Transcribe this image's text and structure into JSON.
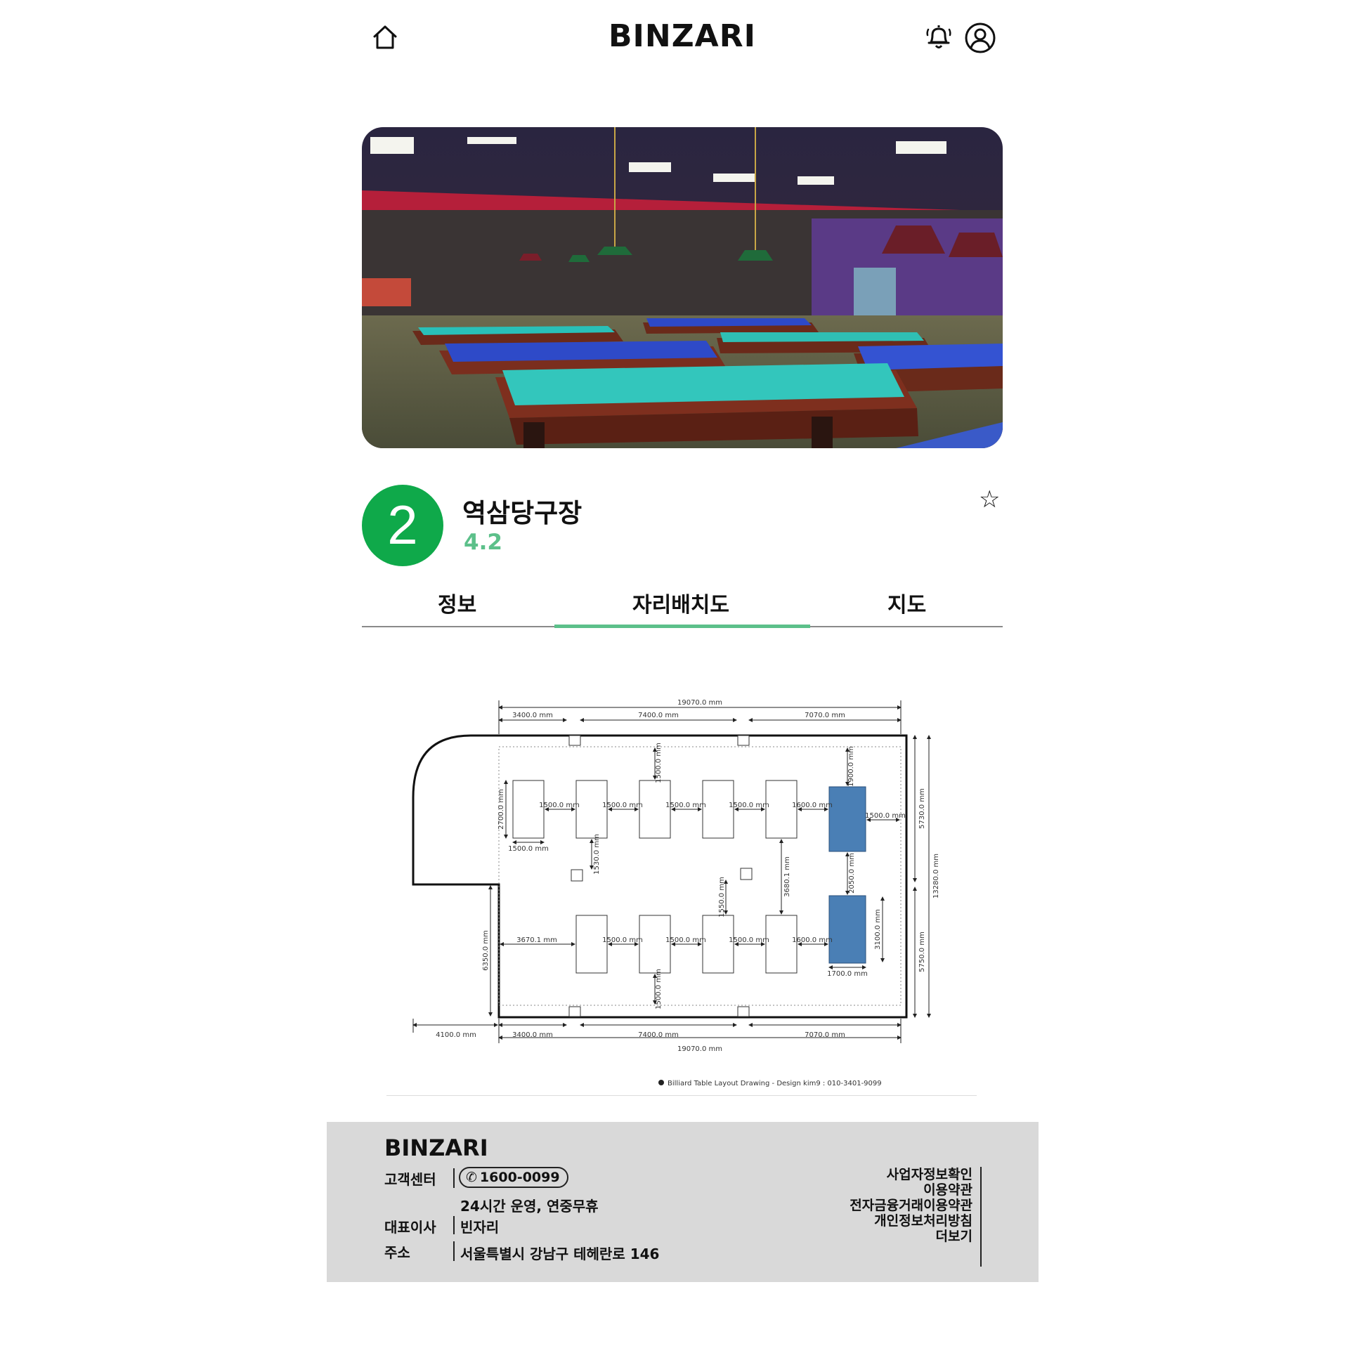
{
  "header": {
    "brand": "BINZARI",
    "icons": [
      "home-icon",
      "bell-icon",
      "user-icon"
    ]
  },
  "store": {
    "logo_number": "2",
    "logo_color": "#0fa94a",
    "name": "역삼당구장",
    "rating": "4.2",
    "favorite_icon": "star-outline-icon"
  },
  "tabs": [
    {
      "label": "정보",
      "active": false
    },
    {
      "label": "자리배치도",
      "active": true
    },
    {
      "label": "지도",
      "active": false
    }
  ],
  "accent_color": "#5cc08a",
  "layout_drawing": {
    "dims_top": {
      "total": "19070.0 mm",
      "a": "3400.0 mm",
      "b": "7400.0 mm",
      "c": "7070.0 mm"
    },
    "dims_bottom": {
      "total": "19070.0 mm",
      "left": "4100.0 mm",
      "a": "3400.0 mm",
      "b": "7400.0 mm",
      "c": "7070.0 mm"
    },
    "right_dims": {
      "upper": "5730.0 mm",
      "lower": "5750.0 mm",
      "total": "13280.0 mm",
      "table_len": "3100.0 mm"
    },
    "left_dims": {
      "table_len": "2700.0 mm",
      "lower": "6350.0 mm"
    },
    "top_row_gaps": [
      "1500.0 mm",
      "1500.0 mm",
      "1500.0 mm",
      "1500.0 mm",
      "1600.0 mm"
    ],
    "bottom_row_gaps": [
      "3670.1 mm",
      "1500.0 mm",
      "1500.0 mm",
      "1500.0 mm",
      "1600.0 mm"
    ],
    "table_width_top": "1500.0 mm",
    "table_width_bottom": "1700.0 mm",
    "right_wall_gap": "1500.0 mm",
    "vertical_labels": {
      "top_clear": "1500.0 mm",
      "right_top_clear": "1900.0 mm",
      "pillar_gap_left": "1530.0 mm",
      "pillar_gap_mid": "1550.0 mm",
      "row_gap": "3680.1 mm",
      "blue_gap": "2050.0 mm",
      "bottom_clear": "1500.0 mm"
    },
    "highlight_color": "#4a7fb5",
    "credit": "Billiard Table Layout Drawing - Design kim9 : 010-3401-9099"
  },
  "footer": {
    "brand": "BINZARI",
    "cs_label": "고객센터",
    "phone": "1600-0099",
    "hours": "24시간 운영, 연중무휴",
    "ceo_label": "대표이사",
    "ceo": "빈자리",
    "addr_label": "주소",
    "address": "서울특별시 강남구 테헤란로 146",
    "links": [
      "사업자정보확인",
      "이용약관",
      "전자금융거래이용약관",
      "개인정보처리방침",
      "더보기"
    ]
  }
}
